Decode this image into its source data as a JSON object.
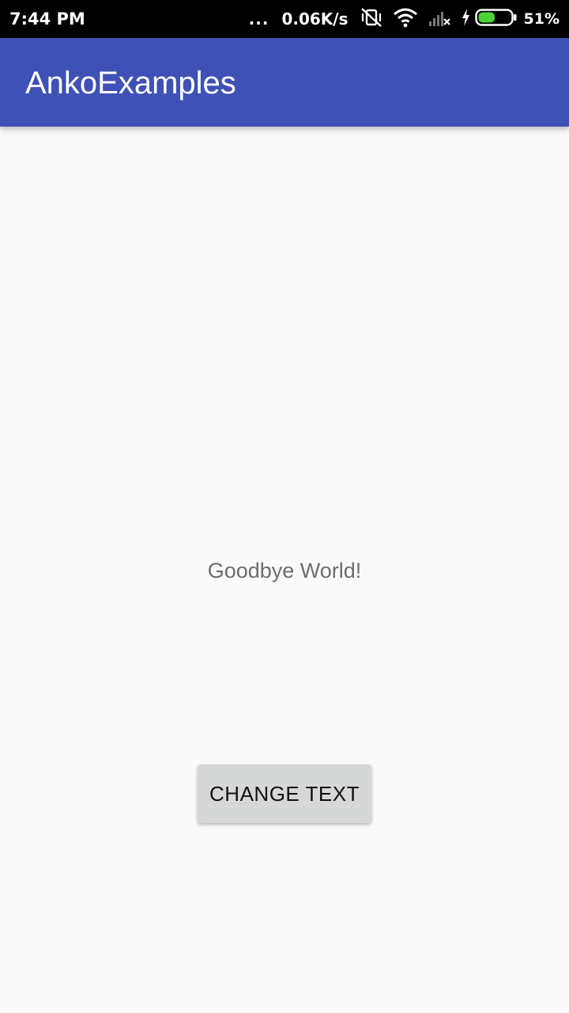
{
  "status_bar": {
    "time": "7:44 PM",
    "dots": "...",
    "net_speed": "0.06K/s",
    "battery_percent": "51%",
    "battery_level": 0.51,
    "icons": [
      "vibrate-off-icon",
      "wifi-icon",
      "signal-icon",
      "charging-icon",
      "battery-icon"
    ]
  },
  "app_bar": {
    "title": "AnkoExamples",
    "color": "#3f51b5"
  },
  "main": {
    "message": "Goodbye World!",
    "button_label": "CHANGE TEXT"
  },
  "colors": {
    "background": "#fafafa",
    "button": "#d6d7d7",
    "message_text": "#6d6d6d",
    "battery_fill": "#4cd137"
  }
}
